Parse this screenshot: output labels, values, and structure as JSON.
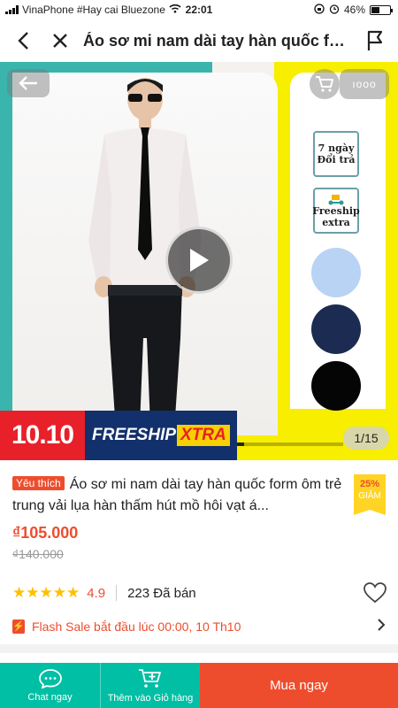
{
  "status_bar": {
    "carrier": "VinaPhone #Hay cai Bluezone",
    "time": "22:01",
    "battery": "46%"
  },
  "nav": {
    "title": "Áo sơ mi nam dài tay hàn quốc form ôm trẻ trung vải lụa hàn thấm hút mồ hôi vạt á..."
  },
  "hero": {
    "more_label": "ıooo",
    "badge_return_line1": "7 ngày",
    "badge_return_line2": "Đổi trả",
    "badge_freeship_line1": "Freeship",
    "badge_freeship_line2": "extra",
    "promo_date": "10.10",
    "promo_freeship": "FREESHIP",
    "promo_xtra": "XTRA",
    "image_counter": "1/15",
    "gallery_progress": 0.067,
    "swatch_colors": [
      "#b9d3f5",
      "#1c2b52",
      "#050505"
    ]
  },
  "product": {
    "favorite_tag": "Yêu thích",
    "title": "Áo sơ mi nam dài tay hàn quốc form ôm trẻ trung vải lụa hàn thấm hút mồ hôi vạt á...",
    "discount_percent": "25%",
    "discount_label": "GIẢM",
    "price": "₫105.000",
    "original_price": "₫140.000",
    "stars": "★★★★★",
    "rating": "4.9",
    "sold": "223 Đã bán",
    "flash_sale": "Flash Sale bắt đầu lúc 00:00, 10 Th10"
  },
  "bottom_bar": {
    "chat_label": "Chat ngay",
    "add_cart_label": "Thêm vào Giỏ hàng",
    "buy_label": "Mua ngay"
  },
  "colors": {
    "accent": "#ee4d2d",
    "teal": "#00bfa5",
    "star": "#ffbf00"
  }
}
